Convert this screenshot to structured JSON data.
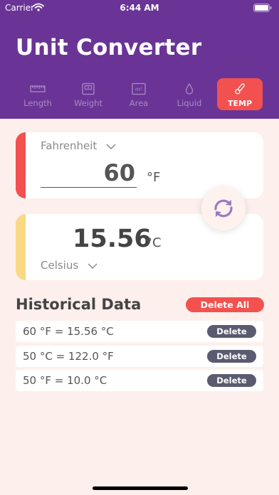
{
  "status_bar": {
    "carrier": "Carrier",
    "time": "6:44 AM"
  },
  "app_title": "Unit Converter",
  "tabs": [
    {
      "label": "Length",
      "icon": "ruler-icon"
    },
    {
      "label": "Weight",
      "icon": "scale-icon"
    },
    {
      "label": "Area",
      "icon": "area-icon"
    },
    {
      "label": "Liquid",
      "icon": "drop-icon"
    },
    {
      "label": "TEMP",
      "icon": "thermometer-icon",
      "active": true
    }
  ],
  "converter": {
    "from_unit": "Fahrenheit",
    "from_value": "60",
    "from_symbol": "°F",
    "to_value": "15.56",
    "to_symbol": "°C",
    "to_unit": "Celsius"
  },
  "history": {
    "title": "Historical Data",
    "delete_all_label": "Delete All",
    "delete_label": "Delete",
    "items": [
      "60 °F = 15.56 °C",
      "50 °C = 122.0 °F",
      "50 °F = 10.0 °C"
    ]
  },
  "colors": {
    "header": "#6a3496",
    "accent": "#f2514f",
    "background": "#fdefeb",
    "from_strip": "#f2514f",
    "to_strip": "#f9d985",
    "delete_button": "#5a5a70",
    "swap_icon": "#9c7ac0"
  }
}
